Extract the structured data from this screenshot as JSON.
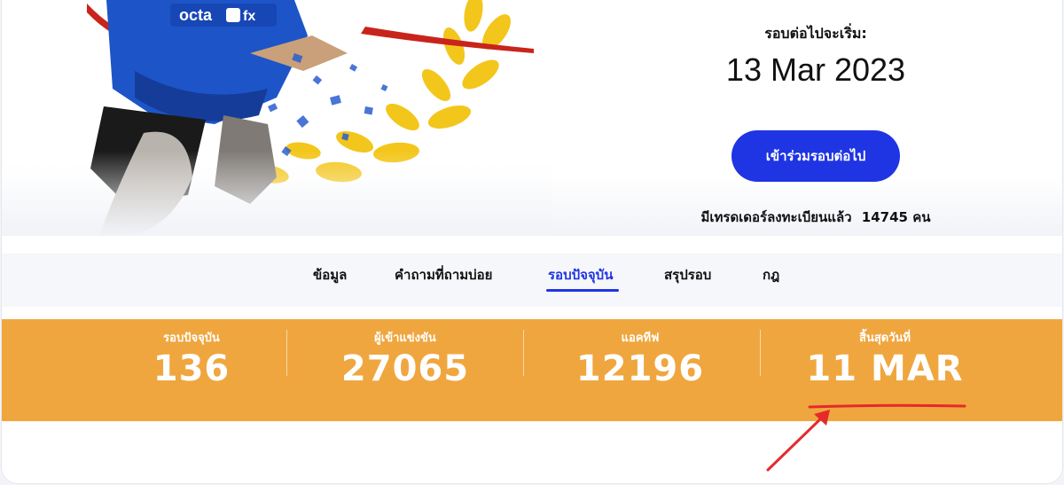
{
  "hero": {
    "next_round_label": "รอบต่อไปจะเริ่ม:",
    "next_round_date": "13 Mar 2023",
    "join_button": "เข้าร่วมรอบต่อไป",
    "registered_text": "มีเทรดเดอร์ลงทะเบียนแล้ว",
    "registered_count": "14745",
    "registered_unit": "คน",
    "logo_text": "octa",
    "logo_fx": "fx"
  },
  "tabs": [
    {
      "label": "ข้อมูล"
    },
    {
      "label": "คำถามที่ถามบ่อย"
    },
    {
      "label": "รอบปัจจุบัน",
      "active": true
    },
    {
      "label": "สรุปรอบ"
    },
    {
      "label": "กฎ"
    }
  ],
  "stats": [
    {
      "label": "รอบปัจจุบัน",
      "value": "136"
    },
    {
      "label": "ผู้เข้าแข่งขัน",
      "value": "27065"
    },
    {
      "label": "แอคทีฟ",
      "value": "12196"
    },
    {
      "label": "สิ้นสุดวันที่",
      "value": "11 MAR"
    }
  ],
  "colors": {
    "accent": "#1f35e3",
    "stats_bg": "#f0a63f",
    "annotation": "#e52a2a"
  }
}
